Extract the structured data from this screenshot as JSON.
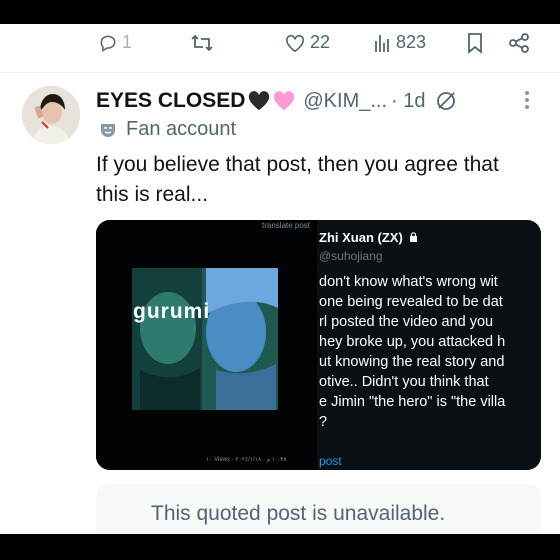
{
  "actions": {
    "reply_count": "1",
    "like_count": "22",
    "view_count": "823"
  },
  "post": {
    "display_name": "EYES CLOSED",
    "name_emojis": "🖤🩷",
    "handle": "@KIM_...",
    "time": "· 1d",
    "label": "Fan account",
    "text": "If you believe that post, then you agree that this is real..."
  },
  "media": {
    "translate_tag": "translate post",
    "image_caption": "gurumi",
    "views_line": "١٠ Views · ١٠:٣٨ م · ٢٠٢٤/١/١٨",
    "embedded_post": {
      "name": "Zhi Xuan (ZX)",
      "handle": "@suhojiang",
      "lines": [
        "don't know what's wrong wit",
        "one being revealed to be dat",
        "rl posted the video and you",
        "hey broke up, you attacked h",
        "ut knowing the real story and",
        "otive.. Didn't you think that",
        "e Jimin \"the hero\" is \"the villa",
        "?"
      ],
      "footer": "post"
    }
  },
  "quoted": {
    "text": "This quoted post is unavailable."
  },
  "colors": {
    "text_primary": "#0f1419",
    "text_secondary": "#536471",
    "link": "#1d9bf0",
    "heart_pink": "#ff9ad5"
  }
}
